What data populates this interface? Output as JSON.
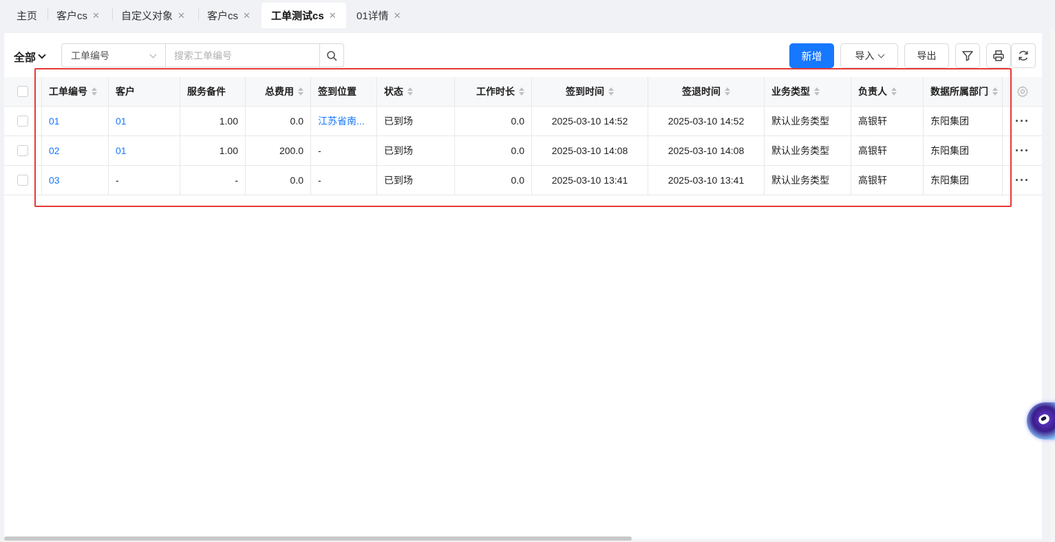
{
  "tabs": [
    {
      "label": "主页",
      "closable": false,
      "active": false
    },
    {
      "label": "客户cs",
      "closable": true,
      "active": false
    },
    {
      "label": "自定义对象",
      "closable": true,
      "active": false
    },
    {
      "label": "客户cs",
      "closable": true,
      "active": false
    },
    {
      "label": "工单测试cs",
      "closable": true,
      "active": true
    },
    {
      "label": "01详情",
      "closable": true,
      "active": false
    }
  ],
  "toolbar": {
    "view_label": "全部",
    "search_field": "工单编号",
    "search_placeholder": "搜索工单编号",
    "new_label": "新增",
    "import_label": "导入",
    "export_label": "导出"
  },
  "table": {
    "columns": [
      "工单编号",
      "客户",
      "服务备件",
      "总费用",
      "签到位置",
      "状态",
      "工作时长",
      "签到时间",
      "签退时间",
      "业务类型",
      "负责人",
      "数据所属部门"
    ],
    "rows": [
      [
        "01",
        "01",
        "1.00",
        "0.0",
        "江苏省南...",
        "已到场",
        "0.0",
        "2025-03-10 14:52",
        "2025-03-10 14:52",
        "默认业务类型",
        "高银轩",
        "东阳集团"
      ],
      [
        "02",
        "01",
        "1.00",
        "200.0",
        "-",
        "已到场",
        "0.0",
        "2025-03-10 14:08",
        "2025-03-10 14:08",
        "默认业务类型",
        "高银轩",
        "东阳集团"
      ],
      [
        "03",
        "-",
        "-",
        "0.0",
        "-",
        "已到场",
        "0.0",
        "2025-03-10 13:41",
        "2025-03-10 13:41",
        "默认业务类型",
        "高银轩",
        "东阳集团"
      ]
    ],
    "row_action": "···"
  },
  "colors": {
    "primary": "#1677ff",
    "highlight_box": "#e53935"
  },
  "icons": {
    "search": "search-icon",
    "filter": "filter-icon",
    "print": "print-icon",
    "refresh": "refresh-icon",
    "settings": "gear-icon"
  }
}
